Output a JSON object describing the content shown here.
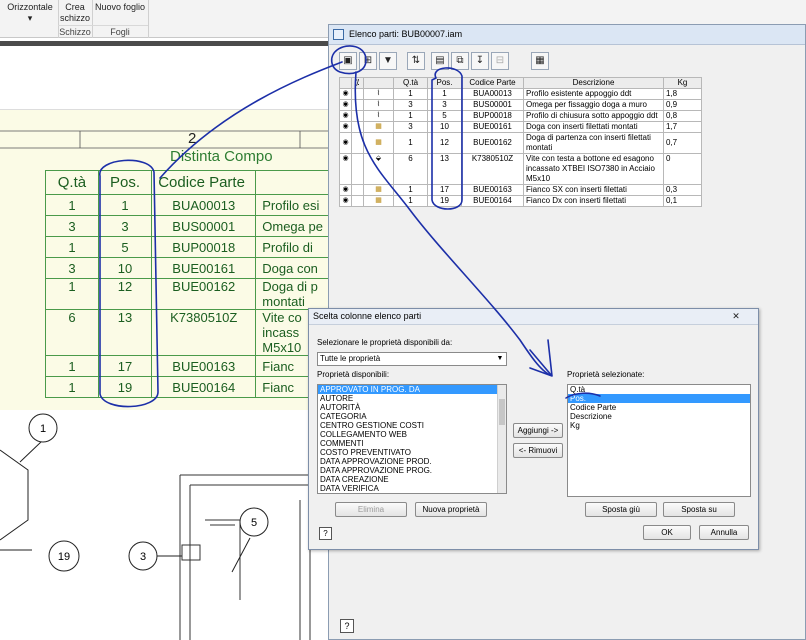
{
  "ribbon": {
    "orizzontale": "Orizzontale",
    "crea_schizzo": "Crea schizzo",
    "nuovo_foglio": "Nuovo foglio",
    "group_schizzo": "Schizzo",
    "group_fogli": "Fogli"
  },
  "drawing": {
    "zone_number": "2",
    "bom_title": "Distinta Compo",
    "headers": [
      "Q.tà",
      "Pos.",
      "Codice Parte"
    ],
    "rows": [
      {
        "qty": "1",
        "pos": "1",
        "code": "BUA00013",
        "desc": "Profilo esi"
      },
      {
        "qty": "3",
        "pos": "3",
        "code": "BUS00001",
        "desc": "Omega pe"
      },
      {
        "qty": "1",
        "pos": "5",
        "code": "BUP00018",
        "desc": "Profilo di"
      },
      {
        "qty": "3",
        "pos": "10",
        "code": "BUE00161",
        "desc": "Doga con"
      },
      {
        "qty": "1",
        "pos": "12",
        "code": "BUE00162",
        "desc": "Doga di p",
        "desc2": "montati"
      },
      {
        "qty": "6",
        "pos": "13",
        "code": "K7380510Z",
        "desc": "Vite co",
        "desc2": "incass",
        "desc3": "M5x10"
      },
      {
        "qty": "1",
        "pos": "17",
        "code": "BUE00163",
        "desc": "Fianc"
      },
      {
        "qty": "1",
        "pos": "19",
        "code": "BUE00164",
        "desc": "Fianc"
      }
    ],
    "balloons": [
      "1",
      "19",
      "3",
      "5"
    ]
  },
  "parts_list": {
    "title": "Elenco parti: BUB00007.iam",
    "columns": [
      "Q.tà",
      "Pos.",
      "Codice Parte",
      "Descrizione",
      "Kg"
    ],
    "rows": [
      {
        "qty": "1",
        "pos": "1",
        "code": "BUA00013",
        "desc": "Profilo esistente appoggio ddt",
        "kg": "1,8"
      },
      {
        "qty": "3",
        "pos": "3",
        "code": "BUS00001",
        "desc": "Omega per fissaggio doga a muro",
        "kg": "0,9"
      },
      {
        "qty": "1",
        "pos": "5",
        "code": "BUP00018",
        "desc": "Profilo di chiusura sotto appoggio ddt",
        "kg": "0,8"
      },
      {
        "qty": "3",
        "pos": "10",
        "code": "BUE00161",
        "desc": "Doga con inserti filettati montati",
        "kg": "1,7"
      },
      {
        "qty": "1",
        "pos": "12",
        "code": "BUE00162",
        "desc": "Doga di partenza con inserti filettati montati",
        "kg": "0,7"
      },
      {
        "qty": "6",
        "pos": "13",
        "code": "K7380510Z",
        "desc": "Vite con testa a bottone ed esagono incassato XTBEI ISO7380 in Acciaio M5x10",
        "kg": "0"
      },
      {
        "qty": "1",
        "pos": "17",
        "code": "BUE00163",
        "desc": "Fianco SX con inserti filettati",
        "kg": "0,3"
      },
      {
        "qty": "1",
        "pos": "19",
        "code": "BUE00164",
        "desc": "Fianco Dx con inserti filettati",
        "kg": "0,1"
      }
    ],
    "help": "?"
  },
  "dialog": {
    "title": "Scelta colonne elenco parti",
    "close": "✕",
    "source_label": "Selezionare le proprietà disponibili da:",
    "source_value": "Tutte le proprietà",
    "available_label": "Proprietà disponibili:",
    "available": [
      "APPROVATO IN PROG. DA",
      "AUTORE",
      "AUTORITÀ",
      "CATEGORIA",
      "CENTRO GESTIONE COSTI",
      "COLLEGAMENTO WEB",
      "COMMENTI",
      "COSTO PREVENTIVATO",
      "DATA APPROVAZIONE PROD.",
      "DATA APPROVAZIONE PROG.",
      "DATA CREAZIONE",
      "DATA VERIFICA"
    ],
    "selected_label": "Proprietà selezionate:",
    "selected": [
      "Q.tà",
      "Pos.",
      "Codice Parte",
      "Descrizione",
      "Kg"
    ],
    "add_button": "Aggiungi ->",
    "remove_button": "<- Rimuovi",
    "delete_button": "Elimina",
    "new_prop_button": "Nuova proprietà",
    "move_down_button": "Sposta giù",
    "move_up_button": "Sposta su",
    "ok_button": "OK",
    "cancel_button": "Annulla",
    "help": "?"
  },
  "colors": {
    "bom_green": "#2e7d32",
    "drawing_bg": "#fbfbe6",
    "annotation_blue": "#1c2fa8",
    "selection_blue": "#3399ff"
  }
}
